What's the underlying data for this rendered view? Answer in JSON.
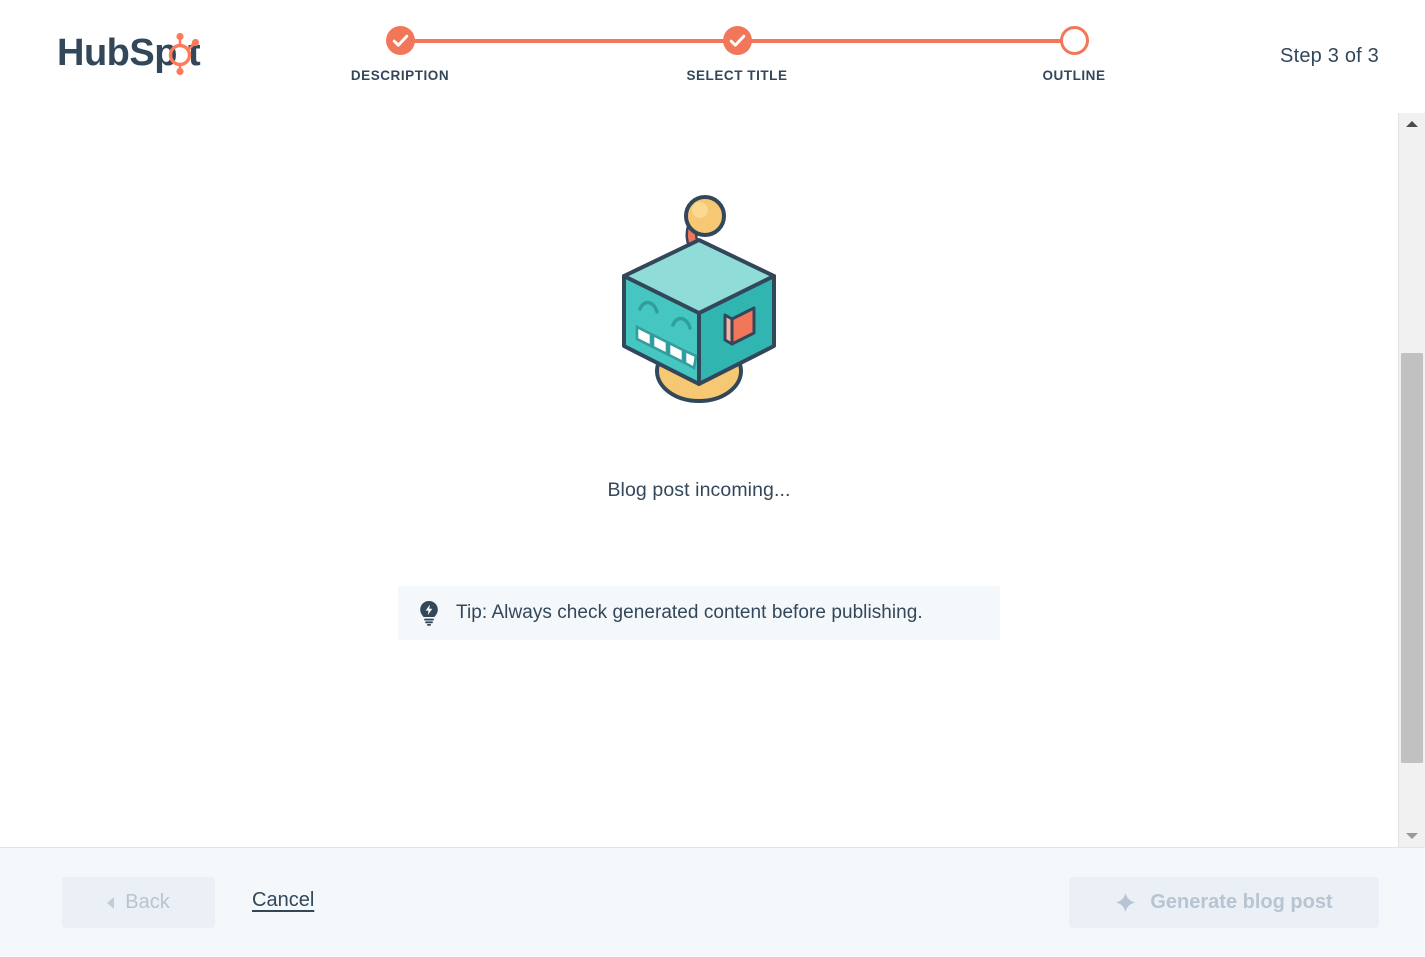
{
  "brand": {
    "name": "HubSpot",
    "logo_text_dark": "HubSp",
    "logo_text_tail": "t",
    "accent_color": "#ff7a59",
    "text_color": "#33475b"
  },
  "header": {
    "steps": [
      {
        "label": "DESCRIPTION",
        "state": "complete",
        "icon": "check-icon"
      },
      {
        "label": "SELECT TITLE",
        "state": "complete",
        "icon": "check-icon"
      },
      {
        "label": "OUTLINE",
        "state": "current",
        "icon": "circle-outline-icon"
      }
    ],
    "step_counter": "Step 3 of 3"
  },
  "main": {
    "illustration_name": "robot-cube-illustration",
    "status_text": "Blog post incoming...",
    "tip": {
      "icon": "lightbulb-icon",
      "text": "Tip: Always check generated content before publishing."
    }
  },
  "footer": {
    "back_label": "Back",
    "back_icon": "chevron-left-icon",
    "cancel_label": "Cancel",
    "generate_label": "Generate blog post",
    "generate_icon": "sparkle-icon"
  },
  "scrollbar": {
    "up_icon": "scroll-up-arrow-icon",
    "down_icon": "scroll-down-arrow-icon",
    "thumb_name": "scrollbar-thumb"
  }
}
